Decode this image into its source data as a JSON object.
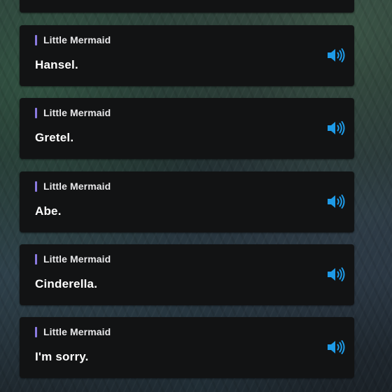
{
  "dialogue": {
    "items": [
      {
        "speaker": "Little Mermaid",
        "text": "Hansel.",
        "audio_icon": "speaker-icon"
      },
      {
        "speaker": "Little Mermaid",
        "text": "Gretel.",
        "audio_icon": "speaker-icon"
      },
      {
        "speaker": "Little Mermaid",
        "text": "Abe.",
        "audio_icon": "speaker-icon"
      },
      {
        "speaker": "Little Mermaid",
        "text": "Cinderella.",
        "audio_icon": "speaker-icon"
      },
      {
        "speaker": "Little Mermaid",
        "text": "I'm sorry.",
        "audio_icon": "speaker-icon"
      }
    ]
  },
  "colors": {
    "speaker_accent": "#8a7ae0",
    "audio_icon": "#1e9be8",
    "card_background": "#121314"
  }
}
